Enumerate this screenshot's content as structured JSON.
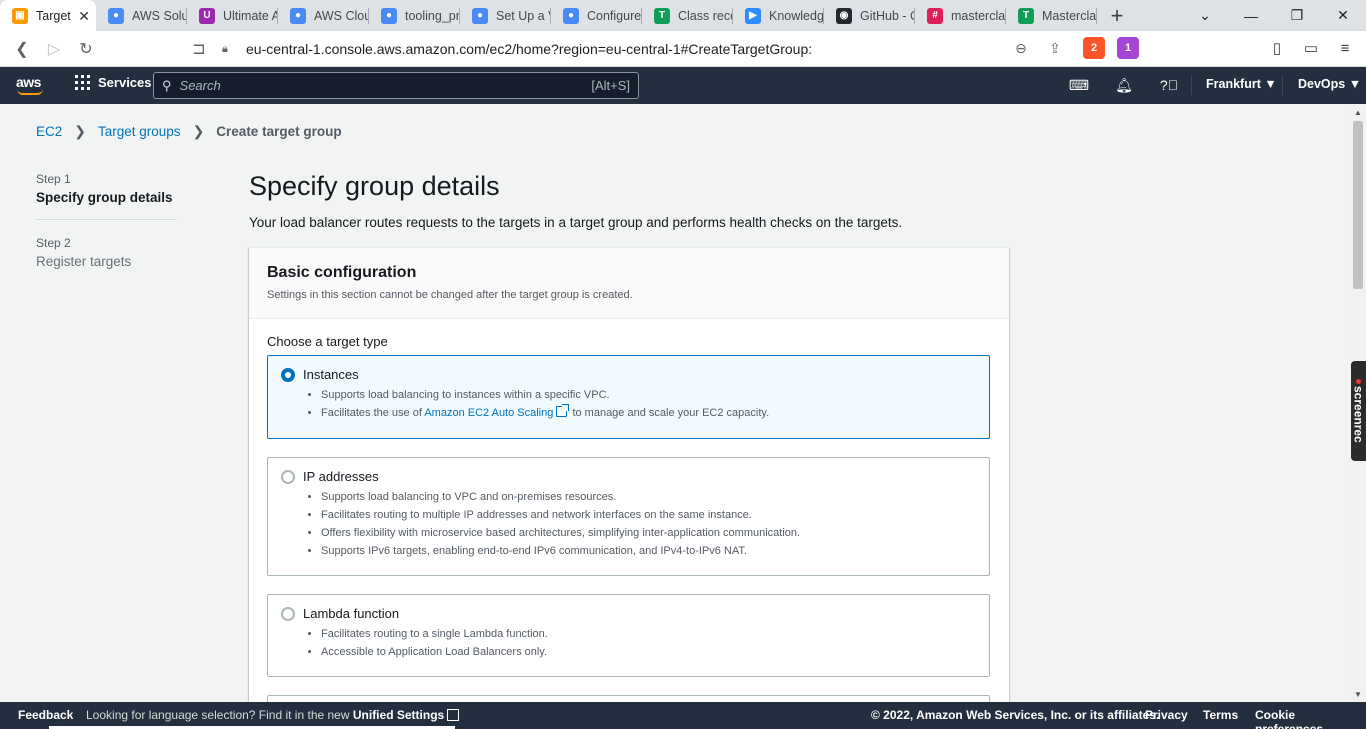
{
  "browser": {
    "tabs": [
      {
        "label": "Target",
        "color": "#ff9900",
        "glyph": "▣",
        "active": true
      },
      {
        "label": "AWS Solut",
        "color": "#4a8af4",
        "glyph": "●"
      },
      {
        "label": "Ultimate A",
        "color": "#9c27b0",
        "glyph": "U"
      },
      {
        "label": "AWS Clou",
        "color": "#4a8af4",
        "glyph": "●"
      },
      {
        "label": "tooling_pr",
        "color": "#4a8af4",
        "glyph": "●"
      },
      {
        "label": "Set Up a V",
        "color": "#4a8af4",
        "glyph": "●"
      },
      {
        "label": "Configure",
        "color": "#4a8af4",
        "glyph": "●"
      },
      {
        "label": "Class reco",
        "color": "#0f9d58",
        "glyph": "T"
      },
      {
        "label": "Knowledg",
        "color": "#2d8cff",
        "glyph": "▶"
      },
      {
        "label": "GitHub - C",
        "color": "#24292f",
        "glyph": "◉"
      },
      {
        "label": "masterclas",
        "color": "#e01e5a",
        "glyph": "#"
      },
      {
        "label": "Mastercla",
        "color": "#0f9d58",
        "glyph": "T"
      }
    ],
    "url": "eu-central-1.console.aws.amazon.com/ec2/home?region=eu-central-1#CreateTargetGroup:",
    "brave_badge": "2",
    "rewards_badge": "1"
  },
  "awsnav": {
    "logo": "aws",
    "services": "Services",
    "search_placeholder": "Search",
    "search_shortcut": "[Alt+S]",
    "region": "Frankfurt ▼",
    "account": "DevOps ▼"
  },
  "breadcrumb": {
    "items": [
      "EC2",
      "Target groups"
    ],
    "current": "Create target group"
  },
  "steps": [
    {
      "num": "Step 1",
      "title": "Specify group details"
    },
    {
      "num": "Step 2",
      "title": "Register targets"
    }
  ],
  "page": {
    "title": "Specify group details",
    "description": "Your load balancer routes requests to the targets in a target group and performs health checks on the targets."
  },
  "basic_config": {
    "title": "Basic configuration",
    "subtitle": "Settings in this section cannot be changed after the target group is created.",
    "target_type_label": "Choose a target type",
    "options": [
      {
        "title": "Instances",
        "selected": true,
        "bullets": [
          "Supports load balancing to instances within a specific VPC."
        ],
        "link_bullet_prefix": "Facilitates the use of",
        "link_text": "Amazon EC2 Auto Scaling",
        "link_bullet_suffix": "to manage and scale your EC2 capacity."
      },
      {
        "title": "IP addresses",
        "selected": false,
        "bullets": [
          "Supports load balancing to VPC and on-premises resources.",
          "Facilitates routing to multiple IP addresses and network interfaces on the same instance.",
          "Offers flexibility with microservice based architectures, simplifying inter-application communication.",
          "Supports IPv6 targets, enabling end-to-end IPv6 communication, and IPv4-to-IPv6 NAT."
        ]
      },
      {
        "title": "Lambda function",
        "selected": false,
        "bullets": [
          "Facilitates routing to a single Lambda function.",
          "Accessible to Application Load Balancers only."
        ]
      }
    ]
  },
  "footer": {
    "feedback": "Feedback",
    "lang_text": "Looking for language selection? Find it in the new",
    "lang_link": "Unified Settings",
    "copyright": "© 2022, Amazon Web Services, Inc. or its affiliates.",
    "privacy": "Privacy",
    "terms": "Terms",
    "cookies": "Cookie preferences"
  },
  "screenrec": "screenrec",
  "colors": {
    "aws_nav": "#232f3e",
    "link": "#0073bb",
    "aws_orange": "#ff9900"
  }
}
